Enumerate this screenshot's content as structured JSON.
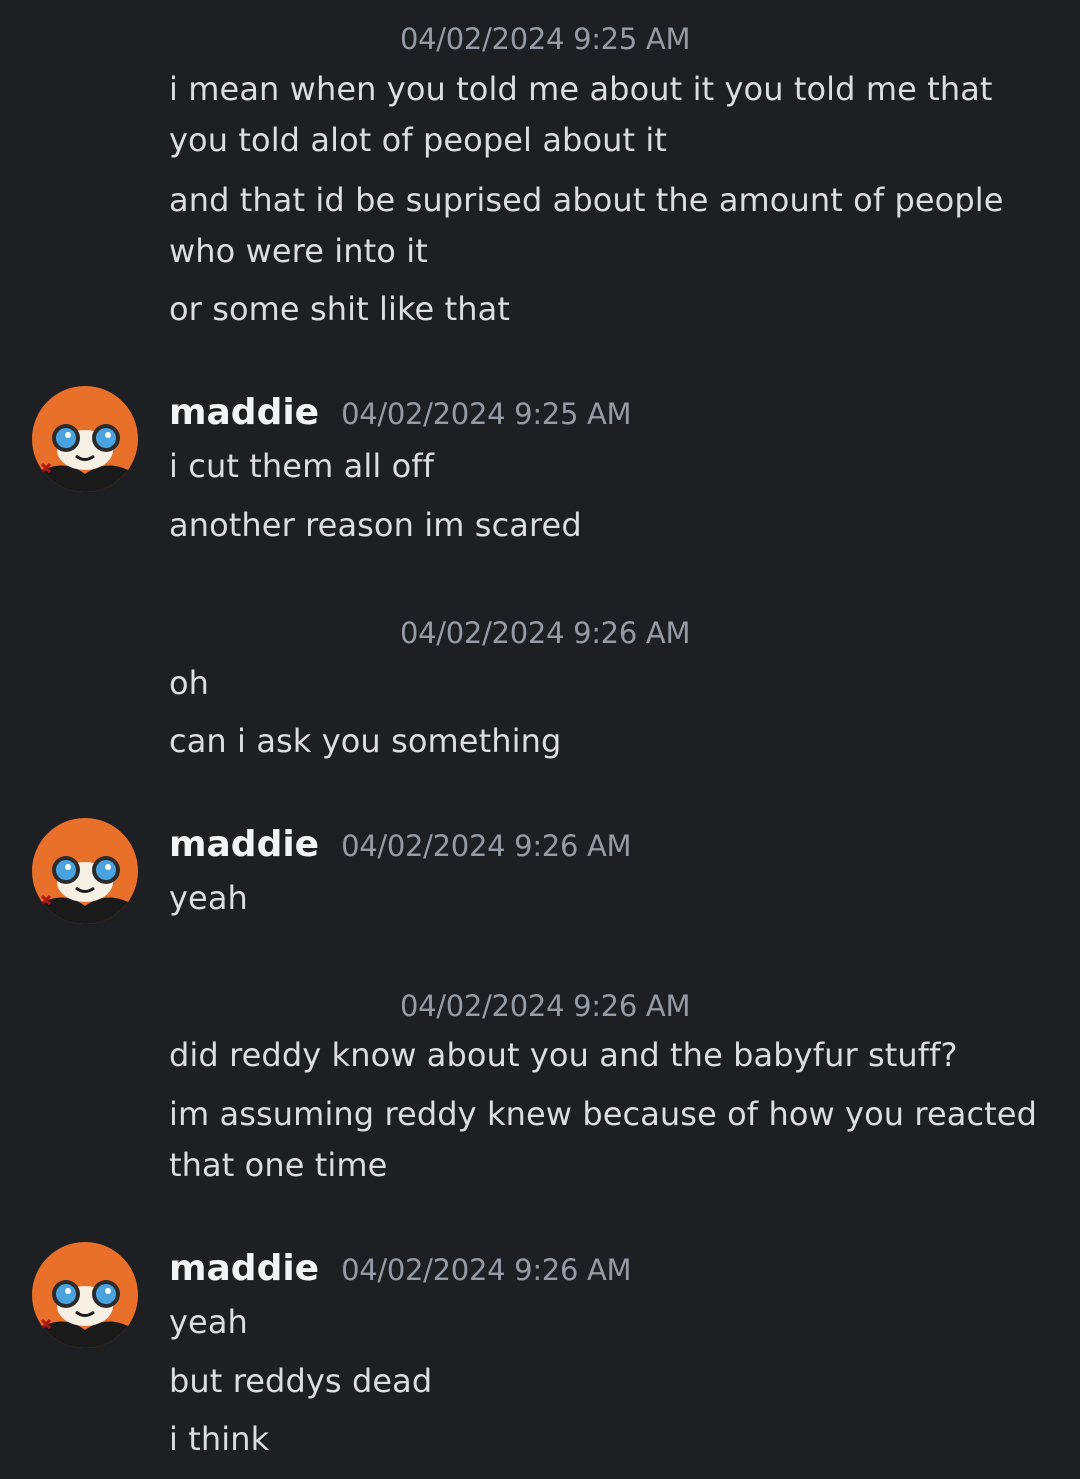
{
  "colors": {
    "background": "#1e1f22",
    "message_text": "#dbdee1",
    "username": "#f2f3f5",
    "timestamp": "#949ba4"
  },
  "groups": [
    {
      "timestamp": "04/02/2024 9:25 AM",
      "messages": [
        "i mean when you told me about it you told me that you told alot of peopel about it",
        "and that id be suprised about the amount of people who were into it",
        "or some shit like that"
      ]
    },
    {
      "author": "maddie",
      "avatar_icon": "red-panda-avatar-icon",
      "timestamp": "04/02/2024 9:25 AM",
      "messages": [
        "i cut them all off",
        "another reason im scared"
      ]
    },
    {
      "timestamp": "04/02/2024 9:26 AM",
      "messages": [
        "oh",
        "can i ask you something"
      ]
    },
    {
      "author": "maddie",
      "avatar_icon": "red-panda-avatar-icon",
      "timestamp": "04/02/2024 9:26 AM",
      "messages": [
        "yeah"
      ]
    },
    {
      "timestamp": "04/02/2024 9:26 AM",
      "messages": [
        "did reddy know about you and the babyfur stuff?",
        "im assuming reddy knew because of how you reacted that one time"
      ]
    },
    {
      "author": "maddie",
      "avatar_icon": "red-panda-avatar-icon",
      "timestamp": "04/02/2024 9:26 AM",
      "messages": [
        "yeah",
        "but reddys dead",
        "i think"
      ]
    }
  ]
}
